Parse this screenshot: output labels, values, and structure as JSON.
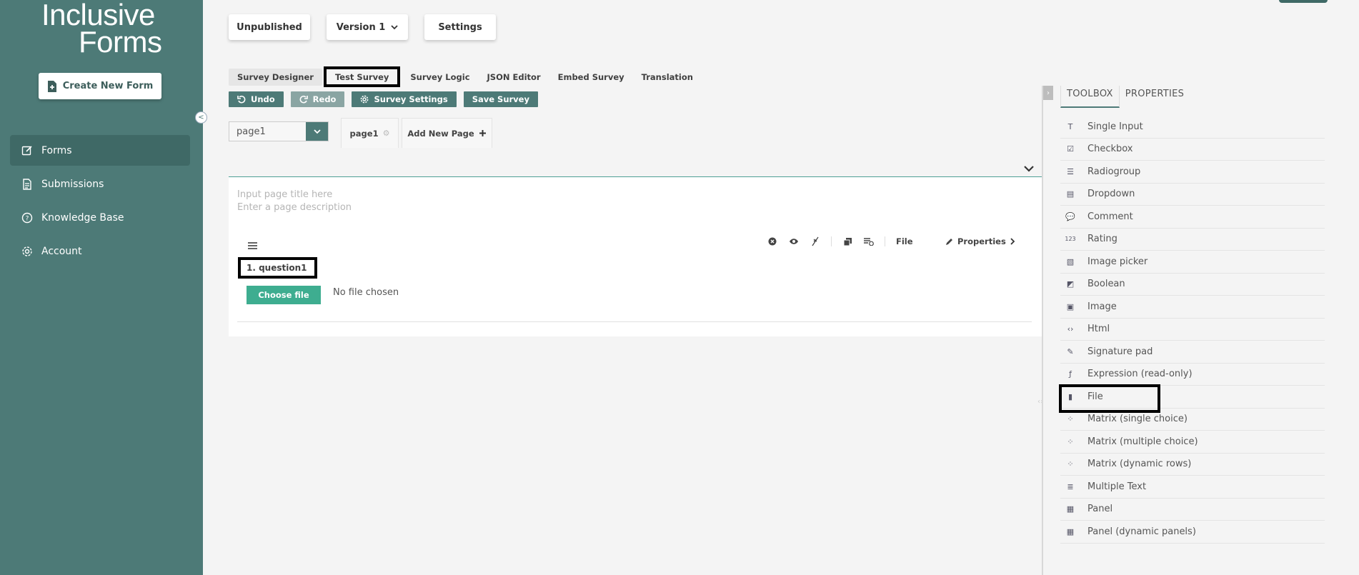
{
  "sidebar": {
    "logo_line1": "Inclusive",
    "logo_line2": "Forms",
    "create_button": "Create New Form",
    "collapse_symbol": "<",
    "items": [
      {
        "label": "Forms",
        "icon": "edit-icon"
      },
      {
        "label": "Submissions",
        "icon": "document-icon"
      },
      {
        "label": "Knowledge Base",
        "icon": "help-icon"
      },
      {
        "label": "Account",
        "icon": "gear-icon"
      }
    ]
  },
  "header": {
    "unpublished": "Unpublished",
    "version": "Version 1",
    "settings": "Settings"
  },
  "tabs": [
    "Survey Designer",
    "Test Survey",
    "Survey Logic",
    "JSON Editor",
    "Embed Survey",
    "Translation"
  ],
  "toolbar": {
    "undo": "Undo",
    "redo": "Redo",
    "survey_settings": "Survey Settings",
    "save_survey": "Save Survey"
  },
  "pages": {
    "selected": "page1",
    "tab_label": "page1",
    "add_new": "Add New Page"
  },
  "design": {
    "title_placeholder": "Input page title here",
    "description_placeholder": "Enter a page description",
    "question_type": "File",
    "properties": "Properties",
    "question_title": "1. question1",
    "choose_file": "Choose file",
    "no_file": "No file chosen"
  },
  "right_panel": {
    "tabs": [
      "TOOLBOX",
      "PROPERTIES"
    ],
    "toolbox": [
      {
        "label": "Single Input",
        "icon": "T"
      },
      {
        "label": "Checkbox",
        "icon": "☑"
      },
      {
        "label": "Radiogroup",
        "icon": "☰"
      },
      {
        "label": "Dropdown",
        "icon": "▤"
      },
      {
        "label": "Comment",
        "icon": "💬"
      },
      {
        "label": "Rating",
        "icon": "123"
      },
      {
        "label": "Image picker",
        "icon": "▧"
      },
      {
        "label": "Boolean",
        "icon": "◩"
      },
      {
        "label": "Image",
        "icon": "▣"
      },
      {
        "label": "Html",
        "icon": "‹›"
      },
      {
        "label": "Signature pad",
        "icon": "✎"
      },
      {
        "label": "Expression (read-only)",
        "icon": "ƒ"
      },
      {
        "label": "File",
        "icon": "▮"
      },
      {
        "label": "Matrix (single choice)",
        "icon": "⁘"
      },
      {
        "label": "Matrix (multiple choice)",
        "icon": "⁘"
      },
      {
        "label": "Matrix (dynamic rows)",
        "icon": "⁘"
      },
      {
        "label": "Multiple Text",
        "icon": "≣"
      },
      {
        "label": "Panel",
        "icon": "▦"
      },
      {
        "label": "Panel (dynamic panels)",
        "icon": "▦"
      }
    ]
  },
  "colors": {
    "sidebar": "#4d7a77",
    "accent": "#3ead90",
    "button": "#4d7a77"
  }
}
